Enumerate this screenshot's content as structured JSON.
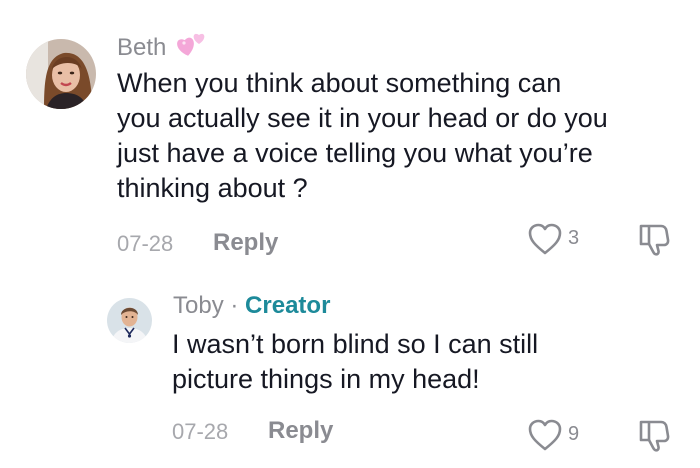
{
  "comments": [
    {
      "username": "Beth",
      "username_decoration": "pink-hearts-emoji",
      "text_lines": [
        "When you think about something can",
        "you actually see it in your head or do you",
        "just have a voice telling you what you’re",
        "thinking about ?"
      ],
      "date": "07-28",
      "reply_label": "Reply",
      "like_count": "3"
    },
    {
      "username": "Toby",
      "separator": "·",
      "badge": "Creator",
      "text_lines": [
        "I wasn’t born blind so I can still",
        "picture things in my head!"
      ],
      "date": "07-28",
      "reply_label": "Reply",
      "like_count": "9"
    }
  ],
  "icons": {
    "like": "heart-outline-icon",
    "dislike": "thumbs-down-outline-icon"
  },
  "colors": {
    "text": "#161823",
    "muted": "#8a8b91",
    "creator_badge": "#1d8a9a",
    "heart_emoji": "#f4a7d8"
  }
}
